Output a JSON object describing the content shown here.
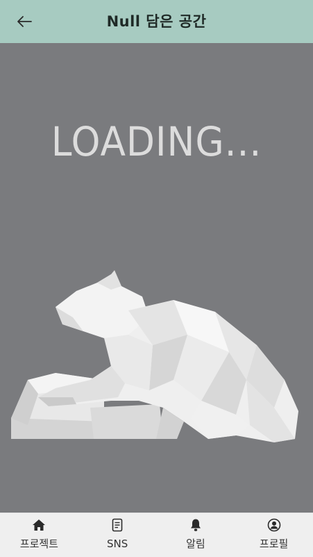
{
  "header": {
    "title": "Null 담은 공간",
    "back_icon": "arrow-left-icon"
  },
  "main": {
    "loading_text": "LOADING...",
    "image": "polygon-bear-sculpture"
  },
  "bottom_nav": {
    "items": [
      {
        "label": "프로젝트",
        "icon": "home-icon"
      },
      {
        "label": "SNS",
        "icon": "document-icon"
      },
      {
        "label": "알림",
        "icon": "bell-icon"
      },
      {
        "label": "프로필",
        "icon": "user-circle-icon"
      }
    ]
  },
  "colors": {
    "header_bg": "#a7cbc1",
    "main_bg": "#7a7b7e",
    "nav_bg": "#efefef",
    "loading_text": "#dcdcdc"
  }
}
